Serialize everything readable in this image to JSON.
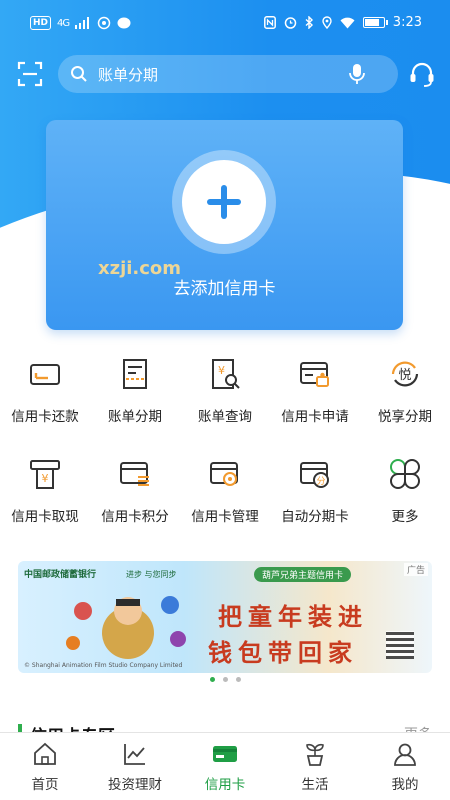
{
  "status_bar": {
    "network": "HD",
    "signal": "4G",
    "time": "3:23",
    "battery_level": 0.8
  },
  "search": {
    "placeholder": "账单分期"
  },
  "add_card": {
    "label": "去添加信用卡"
  },
  "watermark": {
    "text": "xzji.com"
  },
  "features": [
    {
      "label": "信用卡还款",
      "icon": "card-repay-icon"
    },
    {
      "label": "账单分期",
      "icon": "bill-installment-icon"
    },
    {
      "label": "账单查询",
      "icon": "bill-query-icon"
    },
    {
      "label": "信用卡申请",
      "icon": "card-apply-icon"
    },
    {
      "label": "悦享分期",
      "icon": "yue-installment-icon",
      "badge": "悦"
    },
    {
      "label": "信用卡取现",
      "icon": "cash-withdraw-icon"
    },
    {
      "label": "信用卡积分",
      "icon": "card-points-icon"
    },
    {
      "label": "信用卡管理",
      "icon": "card-manage-icon"
    },
    {
      "label": "自动分期卡",
      "icon": "auto-installment-icon",
      "badge": "分"
    },
    {
      "label": "更多",
      "icon": "more-icon"
    }
  ],
  "banner": {
    "bank": "中国邮政储蓄银行",
    "slogan": "进步 与您同步",
    "tag": "广告",
    "title": "葫芦兄弟主题信用卡",
    "line1": "把童年装进",
    "line2": "钱包带回家",
    "copyright": "© Shanghai Animation Film Studio Company Limited",
    "slide_count": 3,
    "active_slide": 1
  },
  "section": {
    "title": "信用卡专区",
    "more": "更多"
  },
  "tabs": [
    {
      "label": "首页",
      "icon": "home-icon",
      "active": false
    },
    {
      "label": "投资理财",
      "icon": "invest-icon",
      "active": false
    },
    {
      "label": "信用卡",
      "icon": "credit-card-icon",
      "active": true
    },
    {
      "label": "生活",
      "icon": "life-plant-icon",
      "active": false
    },
    {
      "label": "我的",
      "icon": "profile-icon",
      "active": false
    }
  ],
  "colors": {
    "primary_blue": "#1c8ff0",
    "accent_orange": "#f29a2e",
    "active_green": "#1f9e45",
    "banner_red": "#c83b1f"
  }
}
